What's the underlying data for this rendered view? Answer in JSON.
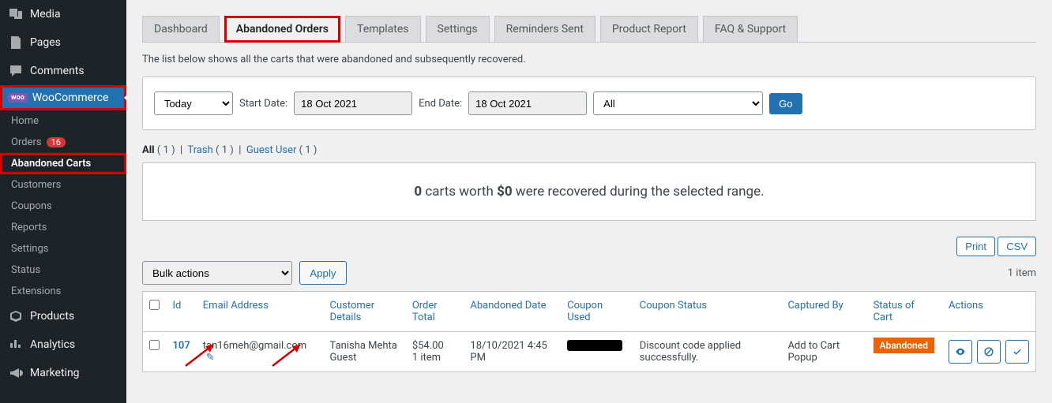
{
  "sidebar": {
    "items": [
      {
        "label": "Media",
        "icon": "media"
      },
      {
        "label": "Pages",
        "icon": "page"
      },
      {
        "label": "Comments",
        "icon": "comment"
      },
      {
        "label": "WooCommerce",
        "icon": "woo",
        "current": true,
        "highlighted": true
      }
    ],
    "submenu": [
      {
        "label": "Home"
      },
      {
        "label": "Orders",
        "badge": "16"
      },
      {
        "label": "Abandoned Carts",
        "current": true,
        "highlighted": true
      },
      {
        "label": "Customers"
      },
      {
        "label": "Coupons"
      },
      {
        "label": "Reports"
      },
      {
        "label": "Settings"
      },
      {
        "label": "Status"
      },
      {
        "label": "Extensions"
      }
    ],
    "items2": [
      {
        "label": "Products",
        "icon": "products"
      },
      {
        "label": "Analytics",
        "icon": "analytics"
      },
      {
        "label": "Marketing",
        "icon": "marketing"
      }
    ]
  },
  "tabs": [
    {
      "label": "Dashboard"
    },
    {
      "label": "Abandoned Orders",
      "active": true,
      "highlighted": true
    },
    {
      "label": "Templates"
    },
    {
      "label": "Settings"
    },
    {
      "label": "Reminders Sent"
    },
    {
      "label": "Product Report"
    },
    {
      "label": "FAQ & Support"
    }
  ],
  "description": "The list below shows all the carts that were abandoned and subsequently recovered.",
  "filter": {
    "range": "Today",
    "start_label": "Start Date:",
    "start_value": "18 Oct 2021",
    "end_label": "End Date:",
    "end_value": "18 Oct 2021",
    "status": "All",
    "go": "Go"
  },
  "subnav": {
    "all_label": "All",
    "all_count": "( 1 )",
    "trash_label": "Trash",
    "trash_count": "( 1 )",
    "guest_label": "Guest User",
    "guest_count": "( 1 )"
  },
  "summary": {
    "prefix": "0",
    "mid": " carts worth ",
    "bold": "$0",
    "suffix": " were recovered during the selected range."
  },
  "export": {
    "print": "Print",
    "csv": "CSV"
  },
  "bulk": {
    "placeholder": "Bulk actions",
    "apply": "Apply",
    "item_count": "1 item"
  },
  "table": {
    "headers": [
      "",
      "Id",
      "Email Address",
      "Customer Details",
      "Order Total",
      "Abandoned Date",
      "Coupon Used",
      "Coupon Status",
      "Captured By",
      "Status of Cart",
      "Actions"
    ],
    "row": {
      "id": "107",
      "email": "tan16meh@gmail.com",
      "customer_name": "Tanisha Mehta",
      "customer_type": "Guest",
      "total": "$54.00",
      "items": "1 item",
      "date": "18/10/2021 4:45 PM",
      "coupon_status": "Discount code applied successfully.",
      "captured_by": "Add to Cart Popup",
      "status": "Abandoned"
    }
  }
}
